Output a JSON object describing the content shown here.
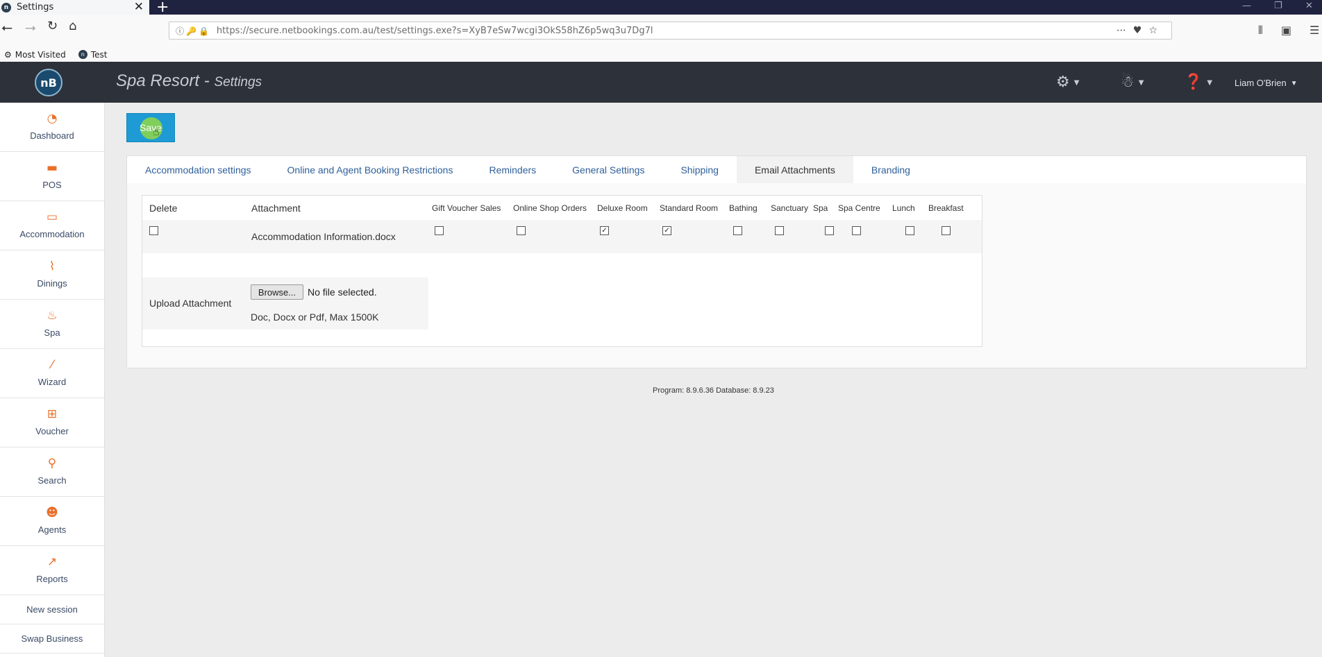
{
  "browser": {
    "tab_title": "Settings",
    "tab_close": "✕",
    "new_tab": "+",
    "url": "https://secure.netbookings.com.au/test/settings.exe?s=XyB7eSw7wcgi3OkS58hZ6p5wq3u7Dg7l",
    "bookmarks": [
      "Most Visited",
      "Test"
    ],
    "favicon_text": "n"
  },
  "header": {
    "logo_text": "nB",
    "title_main": "Spa Resort - ",
    "title_sub": "Settings",
    "user_name": "Liam O'Brien",
    "icons": [
      "gear-icon",
      "ninja-icon",
      "help-icon"
    ]
  },
  "sidebar": {
    "items": [
      {
        "label": "Dashboard",
        "icon": "dashboard-icon"
      },
      {
        "label": "POS",
        "icon": "pos-icon"
      },
      {
        "label": "Accommodation",
        "icon": "bed-icon"
      },
      {
        "label": "Dinings",
        "icon": "dining-icon"
      },
      {
        "label": "Spa",
        "icon": "spa-icon"
      },
      {
        "label": "Wizard",
        "icon": "wand-icon"
      },
      {
        "label": "Voucher",
        "icon": "gift-icon"
      },
      {
        "label": "Search",
        "icon": "search-icon"
      },
      {
        "label": "Agents",
        "icon": "agent-icon"
      },
      {
        "label": "Reports",
        "icon": "chart-icon"
      }
    ],
    "links": [
      "New session",
      "Swap Business"
    ]
  },
  "toolbar": {
    "save_label": "Save"
  },
  "tabs": [
    {
      "label": "Accommodation settings",
      "active": false
    },
    {
      "label": "Online and Agent Booking Restrictions",
      "active": false
    },
    {
      "label": "Reminders",
      "active": false
    },
    {
      "label": "General Settings",
      "active": false
    },
    {
      "label": "Shipping",
      "active": false
    },
    {
      "label": "Email Attachments",
      "active": true
    },
    {
      "label": "Branding",
      "active": false
    }
  ],
  "attachments": {
    "columns": {
      "delete": "Delete",
      "attachment": "Attachment",
      "products": [
        "Gift Voucher Sales",
        "Online Shop Orders",
        "Deluxe Room",
        "Standard Room",
        "Bathing",
        "Sanctuary",
        "Spa",
        "Spa Centre",
        "Lunch",
        "Breakfast"
      ]
    },
    "rows": [
      {
        "delete": false,
        "name": "Accommodation Information.docx",
        "checks": [
          false,
          false,
          true,
          true,
          false,
          false,
          false,
          false,
          false,
          false
        ]
      }
    ],
    "upload": {
      "label": "Upload Attachment",
      "browse_label": "Browse...",
      "no_file": "No file selected.",
      "hint": "Doc, Docx or Pdf, Max 1500K"
    }
  },
  "footer": {
    "version": "Program: 8.9.6.36 Database: 8.9.23"
  },
  "colors": {
    "accent": "#1e9bd4",
    "header_bg": "#2d3139",
    "sidebar_icon": "#e8702a",
    "tab_link": "#2f5f99"
  }
}
